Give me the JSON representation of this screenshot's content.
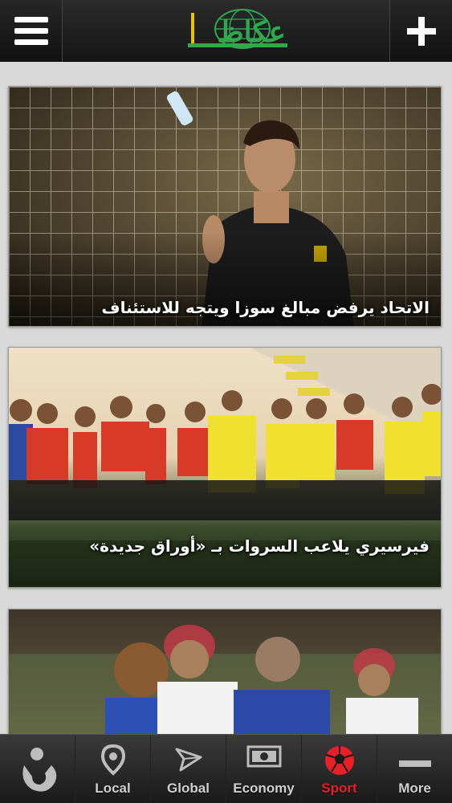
{
  "header": {
    "menu_icon": "hamburger-icon",
    "add_icon": "plus-icon",
    "logo_text": "عكاظ",
    "logo_brand_color": "#2fa84f"
  },
  "articles": [
    {
      "headline": "الاتحاد يرفض مبالغ سوزا ويتجه للاستئناف"
    },
    {
      "headline": "فيرسيري يلاعب السروات بـ «أوراق جديدة»"
    },
    {
      "headline": ""
    }
  ],
  "tabbar": {
    "brand_icon": "okaz-brand-icon",
    "items": [
      {
        "label": "Local",
        "icon": "location-pin-icon"
      },
      {
        "label": "Global",
        "icon": "paper-plane-icon"
      },
      {
        "label": "Economy",
        "icon": "money-icon"
      },
      {
        "label": "Sport",
        "icon": "football-icon",
        "active": true
      },
      {
        "label": "More",
        "icon": "minus-icon"
      }
    ],
    "active_color": "#e8202a"
  }
}
